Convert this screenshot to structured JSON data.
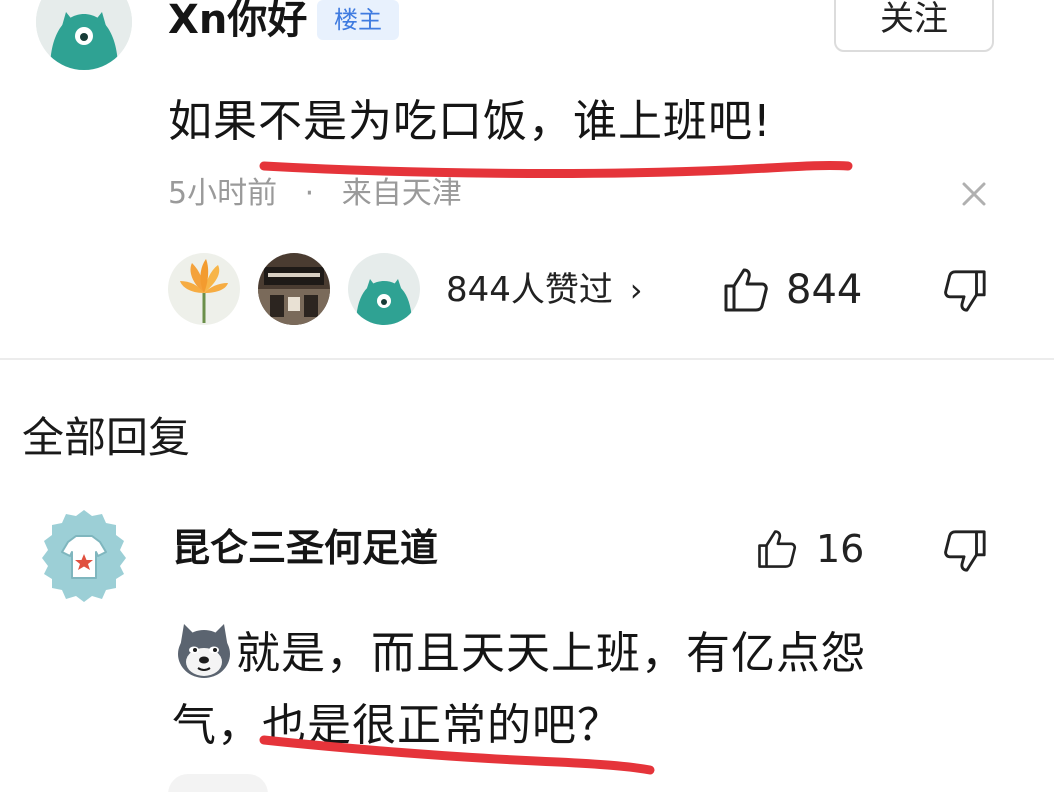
{
  "post": {
    "author_name": "Xn你好",
    "op_badge": "楼主",
    "follow_label": "关注",
    "text": "如果不是为吃口饭，谁上班吧!",
    "time": "5小时前",
    "separator": "·",
    "location": "来自天津",
    "likers_summary": "844人赞过",
    "likers_chevron": "›",
    "like_count": "844"
  },
  "section_title": "全部回复",
  "reply": {
    "author_name": "昆仑三圣何足道",
    "like_count": "16",
    "text_line1": "就是，而且天天上班，有亿点怨",
    "text_line2": "气，也是很正常的吧？"
  },
  "colors": {
    "accent_blue": "#3f7be0",
    "badge_bg": "#e8f1fd",
    "underline_red": "#e5343a",
    "avatar_teal": "#2fa293",
    "meta_gray": "#9a9a9a"
  },
  "icons": {
    "close": "close-icon",
    "thumb_up": "thumb-up-icon",
    "thumb_down": "thumb-down-icon",
    "chevron": "chevron-right-icon"
  }
}
